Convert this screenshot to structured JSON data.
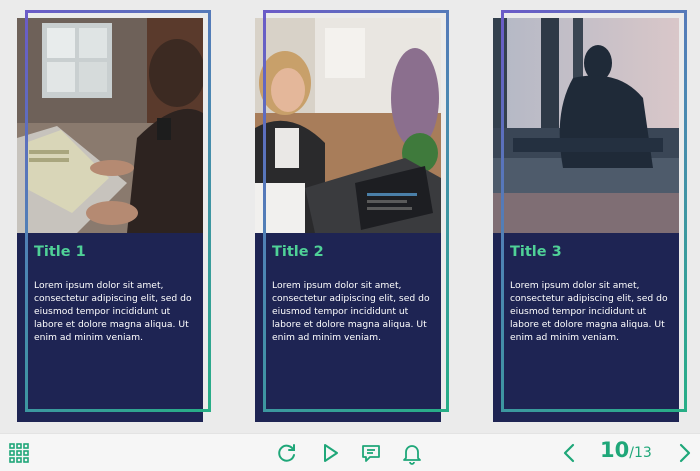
{
  "cards": [
    {
      "title": "Title 1",
      "text": "Lorem ipsum dolor sit amet, consectetur adipiscing elit, sed do eiusmod tempor incididunt ut labore et dolore magna aliqua. Ut enim ad minim veniam."
    },
    {
      "title": "Title 2",
      "text": "Lorem ipsum dolor sit amet, consectetur adipiscing elit, sed do eiusmod tempor incididunt ut labore et dolore magna aliqua. Ut enim ad minim veniam."
    },
    {
      "title": "Title 3",
      "text": "Lorem ipsum dolor sit amet, consectetur adipiscing elit, sed do eiusmod tempor incididunt ut labore et dolore magna aliqua. Ut enim ad minim veniam."
    }
  ],
  "toolbar": {
    "icons": [
      "grid-menu-icon",
      "replay-icon",
      "play-icon",
      "chat-icon",
      "bell-icon",
      "previous-icon",
      "next-icon"
    ],
    "page_current": "10",
    "page_separator": "/",
    "page_total": "13"
  },
  "colors": {
    "accent": "#1fa779",
    "title": "#4fd197",
    "card_background": "#1e2453",
    "frame_start": "#6b5bc7",
    "frame_end": "#27ae86",
    "toolbar_background": "#f6f6f6"
  }
}
